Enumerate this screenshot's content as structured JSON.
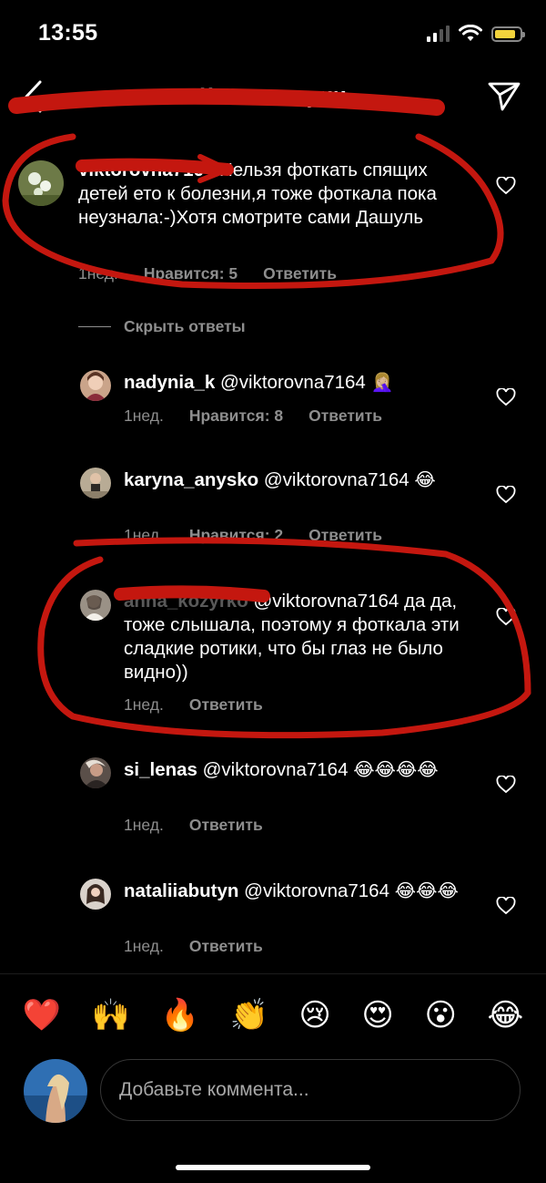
{
  "status_bar": {
    "time": "13:55",
    "battery_level": 0.85
  },
  "header": {
    "title": "Комментарии",
    "back_icon": "chevron-left-icon",
    "send_icon": "paper-plane-icon"
  },
  "comments": [
    {
      "username": "viktorovna7164",
      "text": "Нельзя фоткать спящих детей ето к болезни,я тоже фоткала пока неузнала:-)Хотя смотрите сами Дашуль",
      "time": "1нед.",
      "likes": "Нравится: 5",
      "reply": "Ответить"
    }
  ],
  "hide_replies_label": "Скрыть ответы",
  "replies": [
    {
      "username": "nadynia_k",
      "mention": "@viktorovna7164",
      "emoji": "🤦🏼‍♀️",
      "time": "1нед.",
      "likes": "Нравится: 8",
      "reply": "Ответить"
    },
    {
      "username": "karyna_anysko",
      "mention": "@viktorovna7164",
      "emoji": "😂",
      "time": "1нед.",
      "likes": "Нравится: 2",
      "reply": "Ответить"
    },
    {
      "username": "anna_kozyrko",
      "mention": "@viktorovna7164",
      "text": "да да, тоже слышала, поэтому я фоткала эти сладкие ротики, что бы глаз не было видно))",
      "time": "1нед.",
      "reply": "Ответить"
    },
    {
      "username": "si_lenas",
      "mention": "@viktorovna7164",
      "emoji": "😂😂😂😂",
      "time": "1нед.",
      "reply": "Ответить"
    },
    {
      "username": "nataliiabutyn",
      "mention": "@viktorovna7164",
      "emoji": "😂😂😂",
      "time": "1нед.",
      "reply": "Ответить"
    }
  ],
  "quick_emojis": [
    "❤️",
    "🙌",
    "🔥",
    "👏",
    "😢",
    "😍",
    "😮",
    "😂"
  ],
  "composer": {
    "placeholder": "Добавьте коммента..."
  },
  "colors": {
    "background": "#000000",
    "muted_text": "#8e8e8e",
    "annotation_red": "#c4170f"
  }
}
